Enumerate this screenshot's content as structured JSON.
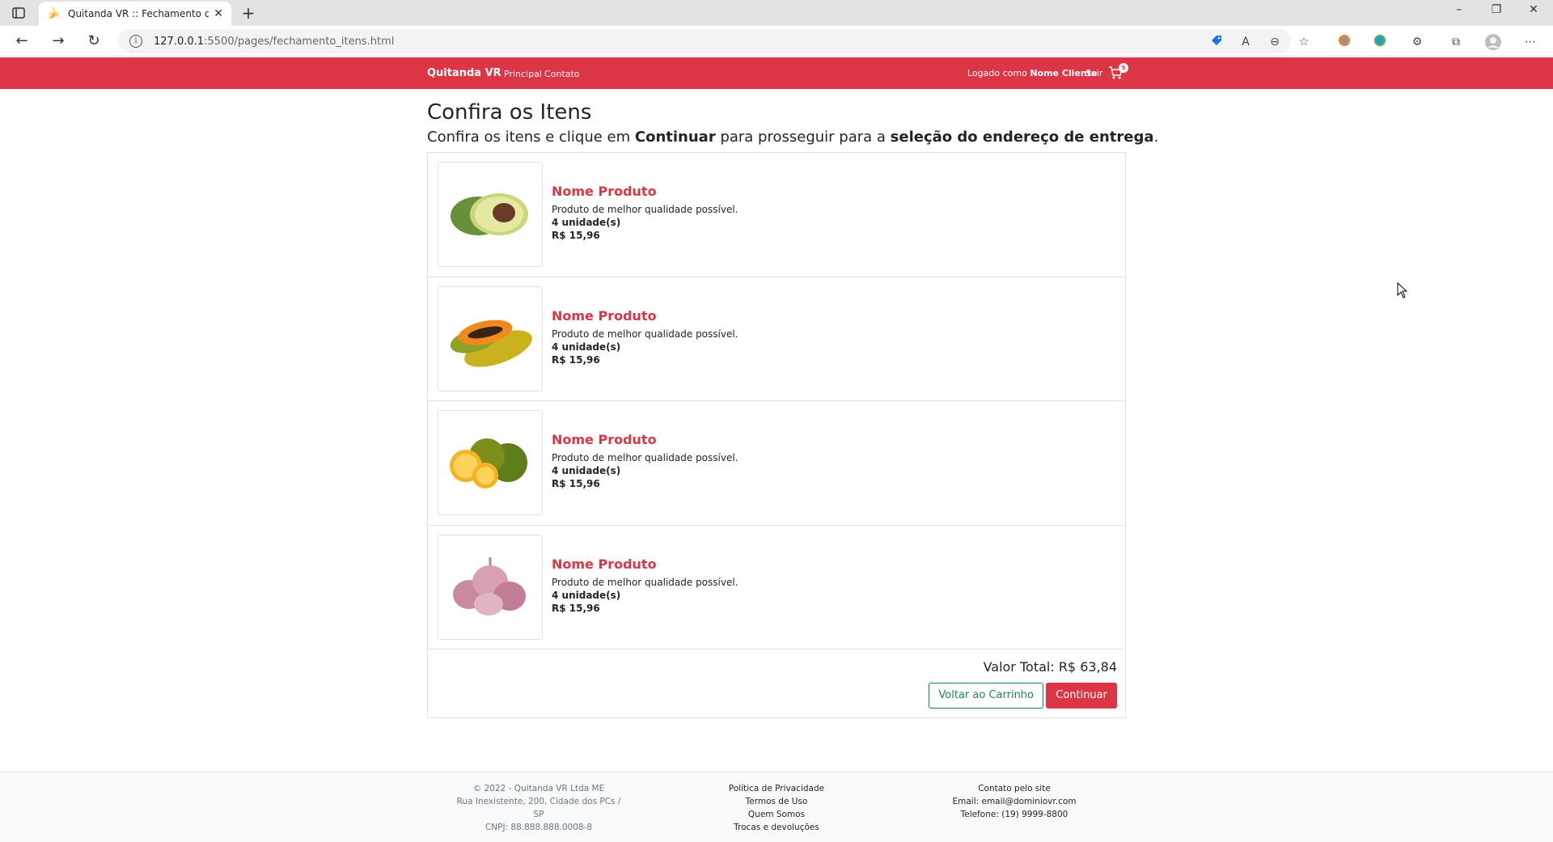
{
  "browser": {
    "tab_title": "Quitanda VR :: Fechamento de C",
    "url_host": "127.0.0.1",
    "url_path": ":5500/pages/fechamento_itens.html"
  },
  "site": {
    "brand": "Quitanda VR",
    "nav": [
      "Principal",
      "Contato"
    ],
    "logged_prefix": "Logado como",
    "user_name": "Nome Cliente",
    "logout": "Sair",
    "cart_count": "5"
  },
  "page": {
    "title": "Confira os Itens",
    "subtitle_1": "Confira os itens e clique em ",
    "subtitle_bold_1": "Continuar",
    "subtitle_2": " para prosseguir para a ",
    "subtitle_bold_2": "seleção do endereço de entrega",
    "subtitle_3": "."
  },
  "items": [
    {
      "name": "Nome Produto",
      "desc": "Produto de melhor qualidade possível.",
      "qty": "4 unidade(s)",
      "price": "R$ 15,96",
      "image": "avocado"
    },
    {
      "name": "Nome Produto",
      "desc": "Produto de melhor qualidade possível.",
      "qty": "4 unidade(s)",
      "price": "R$ 15,96",
      "image": "papaya"
    },
    {
      "name": "Nome Produto",
      "desc": "Produto de melhor qualidade possível.",
      "qty": "4 unidade(s)",
      "price": "R$ 15,96",
      "image": "orange"
    },
    {
      "name": "Nome Produto",
      "desc": "Produto de melhor qualidade possível.",
      "qty": "4 unidade(s)",
      "price": "R$ 15,96",
      "image": "garlic"
    }
  ],
  "summary": {
    "total": "Valor Total: R$ 63,84",
    "back_button": "Voltar ao Carrinho",
    "continue_button": "Continuar"
  },
  "footer": {
    "company": [
      "© 2022 - Quitanda VR Ltda ME",
      "Rua Inexistente, 200, Cidade dos PCs / SP",
      "CNPJ: 88.888.888.0008-8"
    ],
    "links": [
      "Política de Privacidade",
      "Termos de Uso",
      "Quem Somos",
      "Trocas e devoluções"
    ],
    "contact": [
      "Contato pelo site",
      "Email: email@dominiovr.com",
      "Telefone: (19) 9999-8800"
    ]
  },
  "colors": {
    "brand_red": "#dc3545",
    "outline_green": "#198754"
  }
}
